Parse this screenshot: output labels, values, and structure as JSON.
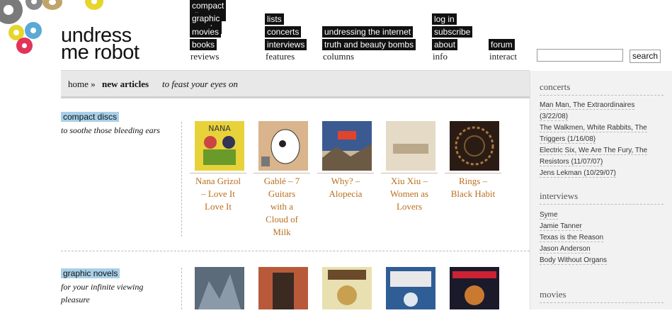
{
  "site": {
    "logo_line1": "undress",
    "logo_line2": "me robot"
  },
  "nav": {
    "reviews": {
      "items": [
        "compact discs",
        "graphic novels",
        "movies",
        "books"
      ],
      "caption": "reviews"
    },
    "features": {
      "items": [
        "lists",
        "concerts",
        "interviews"
      ],
      "caption": "features"
    },
    "columns": {
      "items": [
        "undressing the internet",
        "truth and beauty bombs"
      ],
      "caption": "columns"
    },
    "info": {
      "items": [
        "log in",
        "subscribe",
        "about"
      ],
      "caption": "info"
    },
    "interact": {
      "items": [
        "forum"
      ],
      "caption": "interact"
    }
  },
  "search": {
    "button_label": "search",
    "value": ""
  },
  "breadcrumb": {
    "home": "home »",
    "current": "new articles",
    "tagline": "to feast your eyes on"
  },
  "sections": [
    {
      "label": "compact discs",
      "description": "to soothe those bleeding ears",
      "items": [
        {
          "title_lines": [
            "Nana Grizol",
            "– Love It",
            "Love It"
          ],
          "cover_color": "#e8d23a"
        },
        {
          "title_lines": [
            "Gablé – 7",
            "Guitars",
            "with a",
            "Cloud of",
            "Milk"
          ],
          "cover_color": "#d9b48c"
        },
        {
          "title_lines": [
            "Why? –",
            "Alopecia"
          ],
          "cover_color": "#3b5a92"
        },
        {
          "title_lines": [
            "Xiu Xiu –",
            "Women as",
            "Lovers"
          ],
          "cover_color": "#d7cbb4"
        },
        {
          "title_lines": [
            "Rings –",
            "Black Habit"
          ],
          "cover_color": "#2a1c14"
        }
      ]
    },
    {
      "label": "graphic novels",
      "description_lines": [
        "for your infinite viewing",
        "pleasure"
      ],
      "items": [
        {
          "cover_color": "#5b6b7a"
        },
        {
          "cover_color": "#b85a3a"
        },
        {
          "cover_color": "#e8e0b0"
        },
        {
          "cover_color": "#2f5d96"
        },
        {
          "cover_color": "#1a1a2a"
        }
      ]
    }
  ],
  "sidebar": {
    "concerts": {
      "heading": "concerts",
      "items": [
        [
          "Man Man, The Extraordinaires",
          "(3/22/08)"
        ],
        [
          "The Walkmen, White Rabbits, The",
          "Triggers (1/16/08)"
        ],
        [
          "Electric Six, We Are The Fury, The",
          "Resistors (11/07/07)"
        ],
        [
          "Jens Lekman (10/29/07)"
        ]
      ]
    },
    "interviews": {
      "heading": "interviews",
      "items": [
        "Syme",
        "Jamie Tanner",
        "Texas is the Reason",
        "Jason Anderson",
        "Body Without Organs"
      ]
    },
    "movies": {
      "heading": "movies"
    }
  },
  "colors": {
    "accent_label": "#a8cfe8",
    "link": "#b86e1c",
    "nav_bg": "#111111"
  }
}
